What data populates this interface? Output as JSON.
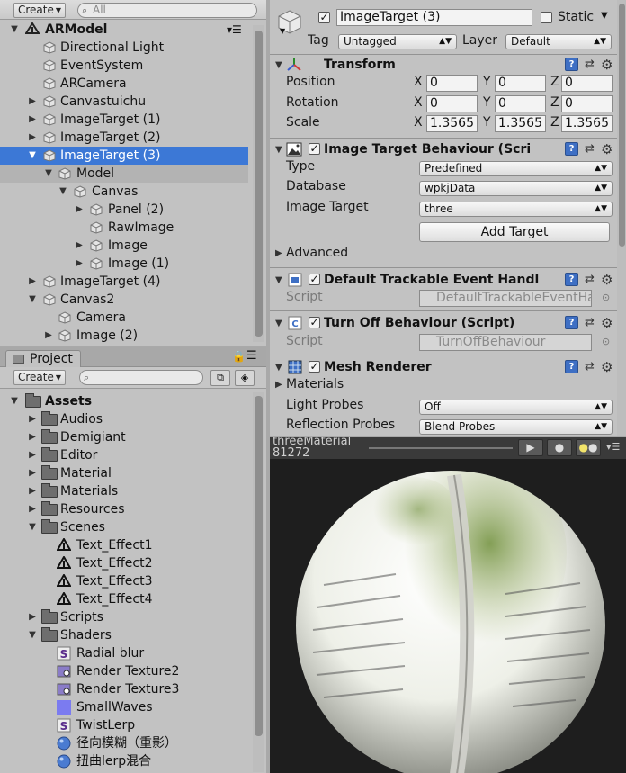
{
  "hierarchy": {
    "create_label": "Create",
    "search_placeholder": "All",
    "scene_name": "ARModel",
    "items": [
      {
        "label": "Directional Light"
      },
      {
        "label": "EventSystem"
      },
      {
        "label": "ARCamera"
      },
      {
        "label": "Canvastuichu"
      },
      {
        "label": "ImageTarget (1)"
      },
      {
        "label": "ImageTarget (2)"
      },
      {
        "label": "ImageTarget (3)"
      },
      {
        "label": "Model"
      },
      {
        "label": "Canvas"
      },
      {
        "label": "Panel (2)"
      },
      {
        "label": "RawImage"
      },
      {
        "label": "Image"
      },
      {
        "label": "Image (1)"
      },
      {
        "label": "ImageTarget (4)"
      },
      {
        "label": "Canvas2"
      },
      {
        "label": "Camera"
      },
      {
        "label": "Image (2)"
      }
    ]
  },
  "project": {
    "tab_label": "Project",
    "create_label": "Create",
    "items": [
      {
        "label": "Assets"
      },
      {
        "label": "Audios"
      },
      {
        "label": "Demigiant"
      },
      {
        "label": "Editor"
      },
      {
        "label": "Material"
      },
      {
        "label": "Materials"
      },
      {
        "label": "Resources"
      },
      {
        "label": "Scenes"
      },
      {
        "label": "Text_Effect1"
      },
      {
        "label": "Text_Effect2"
      },
      {
        "label": "Text_Effect3"
      },
      {
        "label": "Text_Effect4"
      },
      {
        "label": "Scripts"
      },
      {
        "label": "Shaders"
      },
      {
        "label": "Radial blur"
      },
      {
        "label": "Render Texture2"
      },
      {
        "label": "Render Texture3"
      },
      {
        "label": "SmallWaves"
      },
      {
        "label": "TwistLerp"
      },
      {
        "label": "径向模糊（重影）"
      },
      {
        "label": "扭曲lerp混合"
      }
    ]
  },
  "inspector": {
    "object_name": "ImageTarget (3)",
    "static_label": "Static",
    "tag_label": "Tag",
    "tag_value": "Untagged",
    "layer_label": "Layer",
    "layer_value": "Default",
    "transform": {
      "title": "Transform",
      "position_label": "Position",
      "rotation_label": "Rotation",
      "scale_label": "Scale",
      "x": "X",
      "y": "Y",
      "z": "Z",
      "position": [
        "0",
        "0",
        "0"
      ],
      "rotation": [
        "0",
        "0",
        "0"
      ],
      "scale": [
        "1.3565",
        "1.3565",
        "1.3565"
      ]
    },
    "itb": {
      "title": "Image Target Behaviour (Scri",
      "type_label": "Type",
      "type_value": "Predefined",
      "database_label": "Database",
      "database_value": "wpkjData",
      "target_label": "Image Target",
      "target_value": "three",
      "add_target": "Add Target",
      "advanced": "Advanced"
    },
    "dte": {
      "title": "Default Trackable Event Handl",
      "script_label": "Script",
      "script_value": "DefaultTrackableEventHa"
    },
    "tob": {
      "title": "Turn Off Behaviour (Script)",
      "script_label": "Script",
      "script_value": "TurnOffBehaviour"
    },
    "mesh": {
      "title": "Mesh Renderer",
      "materials": "Materials",
      "light_probes_label": "Light Probes",
      "light_probes_value": "Off",
      "reflection_label": "Reflection Probes",
      "reflection_value": "Blend Probes"
    }
  },
  "preview": {
    "name": "threeMaterial",
    "sub": "81272"
  },
  "colors": {
    "selection": "#3c78d6",
    "panel": "#c2c2c2",
    "preview_bg": "#1e1e1e"
  }
}
